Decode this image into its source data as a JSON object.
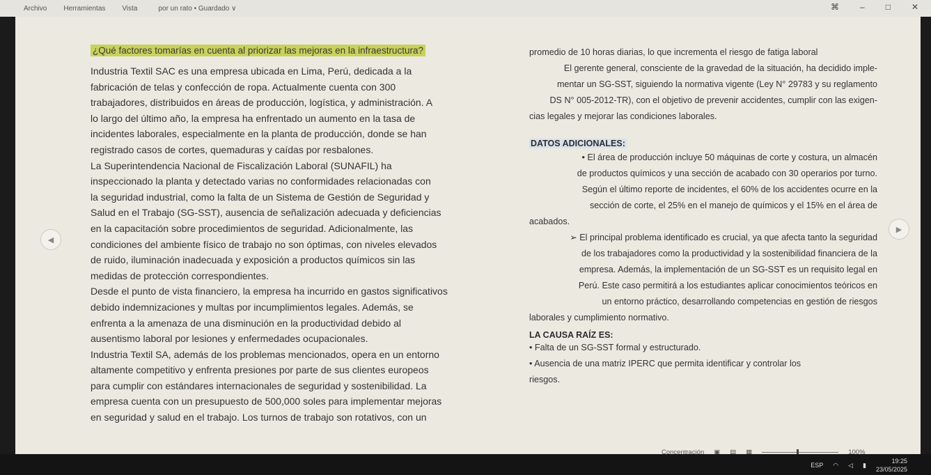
{
  "menu": {
    "items": [
      "Archivo",
      "Herramientas",
      "Vista"
    ],
    "doc_title": "por un rato • Guardado ∨"
  },
  "window": {
    "btn1": "⌘",
    "btn2": "–",
    "btn3": "□",
    "btn4": "✕"
  },
  "left": {
    "question": "¿Qué factores tomarías en cuenta al priorizar las mejoras en la infraestructura?",
    "lines": [
      "Industria Textil SAC es una empresa ubicada en Lima, Perú, dedicada a la",
      "fabricación de telas y confección de ropa. Actualmente cuenta con 300",
      "trabajadores, distribuidos en áreas de producción, logística, y administración. A",
      "lo largo del último año, la empresa ha enfrentado un aumento en la tasa de",
      "incidentes laborales, especialmente en la planta de producción, donde se han",
      "registrado casos de cortes, quemaduras y caídas por resbalones.",
      "La Superintendencia Nacional de Fiscalización Laboral (SUNAFIL) ha",
      "inspeccionado la planta y detectado varias no conformidades relacionadas con",
      "la seguridad industrial, como la falta de un Sistema de Gestión de Seguridad y",
      "Salud en el Trabajo (SG-SST), ausencia de señalización adecuada y deficiencias",
      "en la capacitación sobre procedimientos de seguridad. Adicionalmente, las",
      "condiciones del ambiente físico de trabajo no son óptimas, con niveles elevados",
      "de ruido, iluminación inadecuada y exposición a productos químicos sin las",
      "medidas de protección correspondientes.",
      "Desde el punto de vista financiero, la empresa ha incurrido en gastos significativos",
      "debido indemnizaciones y multas por incumplimientos legales. Además, se",
      "enfrenta a la amenaza de una disminución en la productividad debido al",
      "ausentismo laboral por lesiones y enfermedades ocupacionales.",
      "Industria Textil SA, además de los problemas mencionados, opera en un entorno",
      "altamente competitivo y enfrenta presiones por parte de sus clientes europeos",
      "para cumplir con estándares internacionales de seguridad y sostenibilidad. La",
      "empresa cuenta con un presupuesto de 500,000 soles para implementar mejoras",
      "en seguridad y salud en el trabajo. Los turnos de trabajo son rotativos, con un"
    ]
  },
  "right": {
    "top_lines": [
      "promedio de 10 horas diarias, lo que incrementa el riesgo de fatiga laboral",
      "El gerente general, consciente de la gravedad de la situación, ha decidido imple-",
      "mentar un SG-SST, siguiendo la normativa vigente (Ley N° 29783 y su reglamento",
      "DS N° 005-2012-TR), con el objetivo de prevenir accidentes, cumplir con las exigen-",
      "cias legales y mejorar las condiciones laborales."
    ],
    "section1": "DATOS ADICIONALES:",
    "data_lines": [
      "• El área de producción incluye 50 máquinas de corte y costura, un almacén",
      "de productos químicos y una sección de acabado con 30 operarios por turno.",
      "Según el último reporte de incidentes, el 60% de los accidentes ocurre en la",
      "sección de corte, el 25% en el manejo de químicos y el 15% en el área de",
      "acabados.",
      "➢ El principal problema identificado es crucial, ya que afecta tanto la seguridad",
      "de los trabajadores como la productividad y la sostenibilidad financiera de la",
      "empresa. Además, la implementación de un SG-SST es un requisito legal en",
      "Perú. Este caso permitirá a los estudiantes aplicar conocimientos teóricos en",
      "un entorno práctico, desarrollando competencias en gestión de riesgos",
      "laborales y cumplimiento normativo."
    ],
    "section2": "LA CAUSA RAÍZ ES:",
    "cause_lines": [
      "• Falta de un SG-SST formal y estructurado.",
      "• Ausencia de una matriz IPERC que permita identificar y controlar los",
      "riesgos."
    ]
  },
  "status": {
    "focus": "Concentración",
    "zoom": "100%",
    "zoom_level": 0.45
  },
  "taskbar": {
    "lang": "ESP",
    "time": "19:25",
    "date": "23/05/2025"
  },
  "icons": {
    "prev": "chevron-left-icon",
    "next": "chevron-right-icon"
  }
}
